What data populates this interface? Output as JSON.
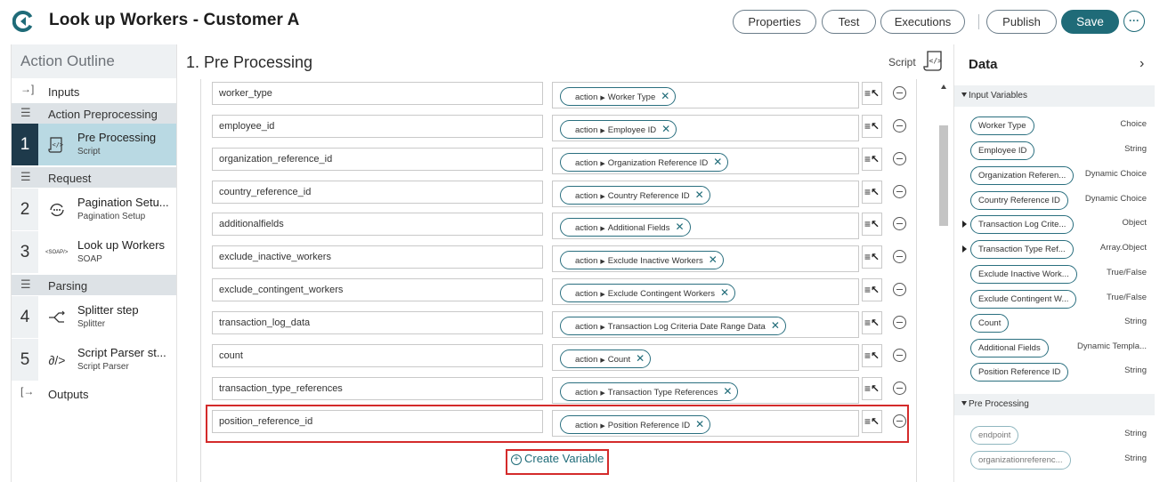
{
  "header": {
    "title": "Look up Workers - Customer A",
    "buttons": {
      "properties": "Properties",
      "test": "Test",
      "executions": "Executions",
      "publish": "Publish",
      "save": "Save",
      "more": "···"
    }
  },
  "outline": {
    "title": "Action Outline",
    "inputs": "Inputs",
    "outputs": "Outputs",
    "sections": {
      "preprocessing": "Action Preprocessing",
      "request": "Request",
      "parsing": "Parsing"
    },
    "steps": [
      {
        "num": "1",
        "name": "Pre Processing",
        "type": "Script",
        "icon": "script-icon"
      },
      {
        "num": "2",
        "name": "Pagination Setu...",
        "type": "Pagination Setup",
        "icon": "pagination-icon"
      },
      {
        "num": "3",
        "name": "Look up Workers",
        "type": "SOAP",
        "icon": "soap-icon",
        "icon_text": "<SOAP/>"
      },
      {
        "num": "4",
        "name": "Splitter step",
        "type": "Splitter",
        "icon": "splitter-icon"
      },
      {
        "num": "5",
        "name": "Script Parser st...",
        "type": "Script Parser",
        "icon": "script-parser-icon"
      }
    ]
  },
  "main": {
    "title": "1.  Pre Processing",
    "script_label": "Script",
    "create_variable": "Create Variable",
    "chip_prefix": "action",
    "rows": [
      {
        "name": "worker_type",
        "value": "Worker Type"
      },
      {
        "name": "employee_id",
        "value": "Employee ID"
      },
      {
        "name": "organization_reference_id",
        "value": "Organization Reference ID"
      },
      {
        "name": "country_reference_id",
        "value": "Country Reference ID"
      },
      {
        "name": "additionalfields",
        "value": "Additional Fields"
      },
      {
        "name": "exclude_inactive_workers",
        "value": "Exclude Inactive Workers"
      },
      {
        "name": "exclude_contingent_workers",
        "value": "Exclude Contingent Workers"
      },
      {
        "name": "transaction_log_data",
        "value": "Transaction Log Criteria Date Range Data"
      },
      {
        "name": "count",
        "value": "Count"
      },
      {
        "name": "transaction_type_references",
        "value": "Transaction Type References"
      },
      {
        "name": "position_reference_id",
        "value": "Position Reference ID"
      }
    ]
  },
  "data_panel": {
    "title": "Data",
    "input_section": "Input Variables",
    "pre_section": "Pre Processing",
    "inputs": [
      {
        "name": "Worker Type",
        "type": "Choice"
      },
      {
        "name": "Employee ID",
        "type": "String"
      },
      {
        "name": "Organization Referen...",
        "type": "Dynamic Choice"
      },
      {
        "name": "Country Reference ID",
        "type": "Dynamic Choice"
      },
      {
        "name": "Transaction Log Crite...",
        "type": "Object",
        "expandable": true
      },
      {
        "name": "Transaction Type Ref...",
        "type": "Array.Object",
        "expandable": true
      },
      {
        "name": "Exclude Inactive Work...",
        "type": "True/False"
      },
      {
        "name": "Exclude Contingent W...",
        "type": "True/False"
      },
      {
        "name": "Count",
        "type": "String"
      },
      {
        "name": "Additional Fields",
        "type": "Dynamic Templa..."
      },
      {
        "name": "Position Reference ID",
        "type": "String"
      }
    ],
    "pre_items": [
      {
        "name": "endpoint",
        "type": "String"
      },
      {
        "name": "organizationreferenc...",
        "type": "String"
      }
    ]
  },
  "colors": {
    "accent": "#1f6b78",
    "active_step": "#b9d9e3",
    "active_num": "#1e3a4b",
    "highlight": "#d42b2b"
  }
}
